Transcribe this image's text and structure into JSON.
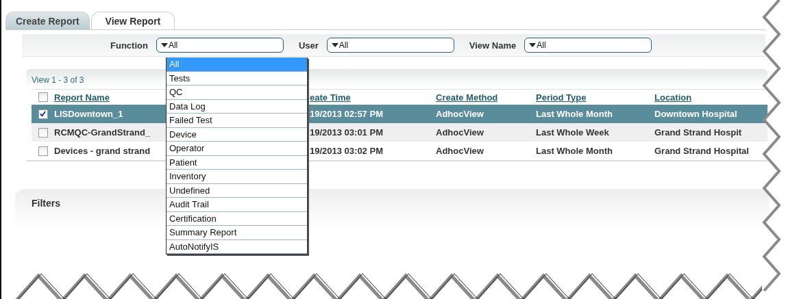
{
  "tabs": [
    {
      "label": "Create Report",
      "selected": false
    },
    {
      "label": "View Report",
      "selected": true
    }
  ],
  "filter_bar": {
    "fields": [
      {
        "label": "Function",
        "value": "All",
        "open": true
      },
      {
        "label": "User",
        "value": "All",
        "open": false
      },
      {
        "label": "View Name",
        "value": "All",
        "open": false
      }
    ]
  },
  "dropdown": {
    "items": [
      {
        "label": "All",
        "selected": true
      },
      {
        "label": "Tests",
        "selected": false
      },
      {
        "label": "QC",
        "selected": false
      },
      {
        "label": "Data Log",
        "selected": false
      },
      {
        "label": "Failed Test",
        "selected": false
      },
      {
        "label": "Device",
        "selected": false
      },
      {
        "label": "Operator",
        "selected": false
      },
      {
        "label": "Patient",
        "selected": false
      },
      {
        "label": "Inventory",
        "selected": false
      },
      {
        "label": "Undefined",
        "selected": false
      },
      {
        "label": "Audit Trail",
        "selected": false
      },
      {
        "label": "Certification",
        "selected": false
      },
      {
        "label": "Summary Report",
        "selected": false
      },
      {
        "label": "AutoNotifyIS",
        "selected": false
      }
    ]
  },
  "table": {
    "count": "View 1 - 3 of 3",
    "header_checked": false,
    "columns": [
      "Report Name",
      "eate Time",
      "Create Method",
      "Period Type",
      "Location"
    ],
    "rows": [
      {
        "checked": true,
        "selected": true,
        "cells": [
          "LISDowntown_1",
          "19/2013 02:57 PM",
          "AdhocView",
          "Last Whole Month",
          "Downtown Hospital"
        ]
      },
      {
        "checked": false,
        "selected": false,
        "cells": [
          "RCMQC-GrandStrand_",
          "19/2013 03:01 PM",
          "AdhocView",
          "Last Whole Week",
          "Grand Strand Hospit"
        ]
      },
      {
        "checked": false,
        "selected": false,
        "cells": [
          "Devices - grand strand",
          "19/2013 03:02 PM",
          "AdhocView",
          "Last Whole Month",
          "Grand Strand Hospital"
        ]
      }
    ]
  },
  "filters": {
    "title": "Filters"
  }
}
